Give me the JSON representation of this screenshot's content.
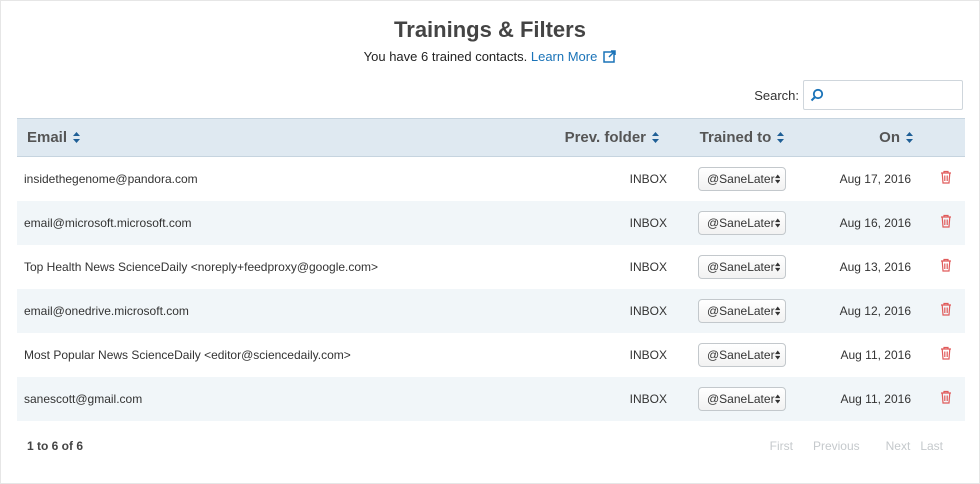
{
  "header": {
    "title": "Trainings & Filters",
    "subtitle_text": "You have 6 trained contacts.",
    "learn_more": "Learn More"
  },
  "search": {
    "label": "Search:",
    "value": "",
    "placeholder": ""
  },
  "table": {
    "columns": {
      "email": "Email",
      "prev_folder": "Prev. folder",
      "trained_to": "Trained to",
      "on": "On"
    },
    "rows": [
      {
        "email": "insidethegenome@pandora.com",
        "prev_folder": "INBOX",
        "trained_to": "@SaneLater",
        "on": "Aug 17, 2016"
      },
      {
        "email": "email@microsoft.microsoft.com",
        "prev_folder": "INBOX",
        "trained_to": "@SaneLater",
        "on": "Aug 16, 2016"
      },
      {
        "email": "Top Health News ScienceDaily <noreply+feedproxy@google.com>",
        "prev_folder": "INBOX",
        "trained_to": "@SaneLater",
        "on": "Aug 13, 2016"
      },
      {
        "email": "email@onedrive.microsoft.com",
        "prev_folder": "INBOX",
        "trained_to": "@SaneLater",
        "on": "Aug 12, 2016"
      },
      {
        "email": "Most Popular News ScienceDaily <editor@sciencedaily.com>",
        "prev_folder": "INBOX",
        "trained_to": "@SaneLater",
        "on": "Aug 11, 2016"
      },
      {
        "email": "sanescott@gmail.com",
        "prev_folder": "INBOX",
        "trained_to": "@SaneLater",
        "on": "Aug 11, 2016"
      }
    ]
  },
  "footer": {
    "count": "1 to 6 of 6",
    "first": "First",
    "previous": "Previous",
    "next": "Next",
    "last": "Last"
  },
  "icons": {
    "external_link": "external-link-icon",
    "search": "search-icon",
    "sort": "sort-arrows-icon",
    "select_arrows": "updown-arrows-icon",
    "delete": "trash-icon"
  },
  "colors": {
    "link": "#1a73b8",
    "header_bg": "#dfe9f1",
    "row_alt": "#f1f6f9",
    "trash": "#e05a5a",
    "pager_disabled": "#c5c9cc"
  }
}
